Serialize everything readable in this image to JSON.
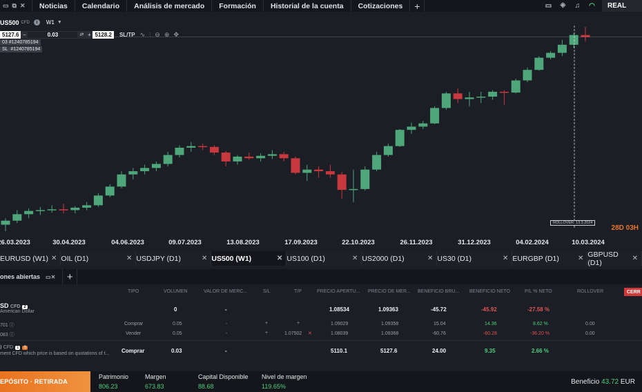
{
  "topnav": {
    "items": [
      "Noticias",
      "Calendario",
      "Análisis de mercado",
      "Formación",
      "Historial de la cuenta",
      "Cotizaciones"
    ],
    "account_label": "REAL",
    "icons": [
      "window-icon",
      "popout-icon",
      "close-icon",
      "plus-icon",
      "screen-icon",
      "network-icon",
      "bell-icon",
      "wifi-icon"
    ]
  },
  "chart": {
    "symbol": "US500",
    "symbol_type": "CFD",
    "timeframe": "W1",
    "sell_price": "5127.6",
    "volume": "0.03",
    "buy_price": "5128.2",
    "sltp_label": "SL/TP",
    "tag_order_a": "#1240785194",
    "tag_order_b": "#1240785194",
    "tag_prefix_a": "03",
    "tag_prefix_b": "SL",
    "rollover_label": "ROLLOVER: 13.3.2024",
    "countdown": "28D 03H",
    "accent_up": "#4ea67a",
    "accent_down": "#c8393f"
  },
  "chart_data": {
    "type": "candlestick",
    "x_tick_labels": [
      "26.03.2023",
      "30.04.2023",
      "04.06.2023",
      "09.07.2023",
      "13.08.2023",
      "17.09.2023",
      "22.10.2023",
      "26.11.2023",
      "31.12.2023",
      "04.02.2024",
      "10.03.2024"
    ],
    "grid": false,
    "candles": [
      {
        "o": 3970,
        "h": 4010,
        "l": 3930,
        "c": 3995
      },
      {
        "o": 3995,
        "h": 4060,
        "l": 3980,
        "c": 4035
      },
      {
        "o": 4035,
        "h": 4070,
        "l": 4010,
        "c": 4055
      },
      {
        "o": 4055,
        "h": 4080,
        "l": 4030,
        "c": 4060
      },
      {
        "o": 4060,
        "h": 4090,
        "l": 4045,
        "c": 4065
      },
      {
        "o": 4065,
        "h": 4100,
        "l": 4040,
        "c": 4060
      },
      {
        "o": 4060,
        "h": 4085,
        "l": 4040,
        "c": 4075
      },
      {
        "o": 4075,
        "h": 4110,
        "l": 4060,
        "c": 4090
      },
      {
        "o": 4090,
        "h": 4165,
        "l": 4080,
        "c": 4150
      },
      {
        "o": 4150,
        "h": 4220,
        "l": 4140,
        "c": 4205
      },
      {
        "o": 4205,
        "h": 4300,
        "l": 4195,
        "c": 4280
      },
      {
        "o": 4280,
        "h": 4320,
        "l": 4250,
        "c": 4300
      },
      {
        "o": 4300,
        "h": 4340,
        "l": 4280,
        "c": 4320
      },
      {
        "o": 4320,
        "h": 4360,
        "l": 4300,
        "c": 4345
      },
      {
        "o": 4345,
        "h": 4420,
        "l": 4330,
        "c": 4400
      },
      {
        "o": 4400,
        "h": 4460,
        "l": 4385,
        "c": 4445
      },
      {
        "o": 4445,
        "h": 4480,
        "l": 4420,
        "c": 4455
      },
      {
        "o": 4455,
        "h": 4470,
        "l": 4430,
        "c": 4450
      },
      {
        "o": 4450,
        "h": 4460,
        "l": 4400,
        "c": 4415
      },
      {
        "o": 4415,
        "h": 4425,
        "l": 4330,
        "c": 4360
      },
      {
        "o": 4360,
        "h": 4400,
        "l": 4340,
        "c": 4390
      },
      {
        "o": 4390,
        "h": 4415,
        "l": 4370,
        "c": 4380
      },
      {
        "o": 4380,
        "h": 4410,
        "l": 4360,
        "c": 4395
      },
      {
        "o": 4395,
        "h": 4430,
        "l": 4375,
        "c": 4405
      },
      {
        "o": 4405,
        "h": 4420,
        "l": 4360,
        "c": 4380
      },
      {
        "o": 4380,
        "h": 4390,
        "l": 4280,
        "c": 4290
      },
      {
        "o": 4290,
        "h": 4340,
        "l": 4240,
        "c": 4310
      },
      {
        "o": 4310,
        "h": 4330,
        "l": 4260,
        "c": 4300
      },
      {
        "o": 4300,
        "h": 4340,
        "l": 4260,
        "c": 4280
      },
      {
        "o": 4280,
        "h": 4295,
        "l": 4130,
        "c": 4185
      },
      {
        "o": 4185,
        "h": 4310,
        "l": 4110,
        "c": 4190
      },
      {
        "o": 4190,
        "h": 4330,
        "l": 4180,
        "c": 4310
      },
      {
        "o": 4310,
        "h": 4420,
        "l": 4300,
        "c": 4400
      },
      {
        "o": 4400,
        "h": 4470,
        "l": 4390,
        "c": 4455
      },
      {
        "o": 4455,
        "h": 4560,
        "l": 4450,
        "c": 4555
      },
      {
        "o": 4555,
        "h": 4600,
        "l": 4530,
        "c": 4575
      },
      {
        "o": 4575,
        "h": 4610,
        "l": 4560,
        "c": 4595
      },
      {
        "o": 4595,
        "h": 4700,
        "l": 4590,
        "c": 4690
      },
      {
        "o": 4690,
        "h": 4790,
        "l": 4680,
        "c": 4780
      },
      {
        "o": 4780,
        "h": 4810,
        "l": 4720,
        "c": 4745
      },
      {
        "o": 4745,
        "h": 4790,
        "l": 4700,
        "c": 4755
      },
      {
        "o": 4755,
        "h": 4790,
        "l": 4720,
        "c": 4760
      },
      {
        "o": 4760,
        "h": 4800,
        "l": 4740,
        "c": 4790
      },
      {
        "o": 4790,
        "h": 4800,
        "l": 4710,
        "c": 4785
      },
      {
        "o": 4785,
        "h": 4870,
        "l": 4780,
        "c": 4860
      },
      {
        "o": 4860,
        "h": 4940,
        "l": 4850,
        "c": 4925
      },
      {
        "o": 4925,
        "h": 5010,
        "l": 4920,
        "c": 5000
      },
      {
        "o": 5000,
        "h": 5040,
        "l": 4990,
        "c": 5030
      },
      {
        "o": 5030,
        "h": 5110,
        "l": 5010,
        "c": 5080
      },
      {
        "o": 5080,
        "h": 5150,
        "l": 5060,
        "c": 5140
      },
      {
        "o": 5140,
        "h": 5190,
        "l": 5100,
        "c": 5127.6
      }
    ],
    "price_range": [
      3930,
      5190
    ]
  },
  "tabs": [
    {
      "label": "EURUSD (W1)",
      "active": false
    },
    {
      "label": "OIL (D1)",
      "active": false
    },
    {
      "label": "USDJPY (D1)",
      "active": false
    },
    {
      "label": "US500 (W1)",
      "active": true
    },
    {
      "label": "US100 (D1)",
      "active": false
    },
    {
      "label": "US2000 (D1)",
      "active": false
    },
    {
      "label": "US30 (D1)",
      "active": false
    },
    {
      "label": "EURGBP (D1)",
      "active": false
    },
    {
      "label": "GBPUSD (D1)",
      "active": false
    }
  ],
  "positions_panel": {
    "title": "ones abiertas",
    "close_button": "CERR",
    "headers": [
      "TIPO",
      "VOLUMEN",
      "VALOR DE MERC...",
      "S/L",
      "T/P",
      "PRECIO APERTU...",
      "PRECIO DE MER...",
      "BENEFICIO BRU...",
      "BENEFICIO NETO",
      "P/L % NETO",
      "ROLLOVER"
    ],
    "group1": {
      "symbol": "SD",
      "symbol_type": "CFD",
      "count": "2",
      "description": "American Dollar",
      "volume": "0",
      "market_value": "-",
      "open_price": "1.08534",
      "market_price": "1.09363",
      "gross": "-45.72",
      "net": "-45.92",
      "pl_pct": "-27.58 %"
    },
    "rows": [
      {
        "id": "701",
        "type": "Comprar",
        "volume": "0.05",
        "market_value": "-",
        "tp": "",
        "open": "1.09029",
        "market": "1.09358",
        "gross": "15.04",
        "net": "14.36",
        "pl": "8.62 %",
        "rollover": "0.00"
      },
      {
        "id": "083",
        "type": "Vender",
        "volume": "0.05",
        "market_value": "-",
        "tp": "1.07502",
        "open": "1.08039",
        "market": "1.09368",
        "gross": "-60.76",
        "net": "-60.28",
        "pl": "-36.20 %",
        "rollover": "0.00"
      }
    ],
    "group2": {
      "symbol_type": "CFD",
      "count": "1",
      "description": "ment CFD which price is based on quotations of t...",
      "type": "Comprar",
      "volume": "0.03",
      "market_value": "-",
      "open_price": "5110.1",
      "market_price": "5127.6",
      "gross": "24.00",
      "net": "9.35",
      "pl_pct": "2.66 %"
    }
  },
  "footer": {
    "deposit_label": "EPÓSITO · RETIRADA",
    "stats": [
      {
        "label": "Patrimonio",
        "value": "806.23"
      },
      {
        "label": "Margen",
        "value": "673.83"
      },
      {
        "label": "Capital Disponible",
        "value": "88.68"
      },
      {
        "label": "Nivel de margen",
        "value": "119.65%"
      }
    ],
    "profit_label": "Beneficio",
    "profit_value": "43.72",
    "currency": "EUR"
  }
}
